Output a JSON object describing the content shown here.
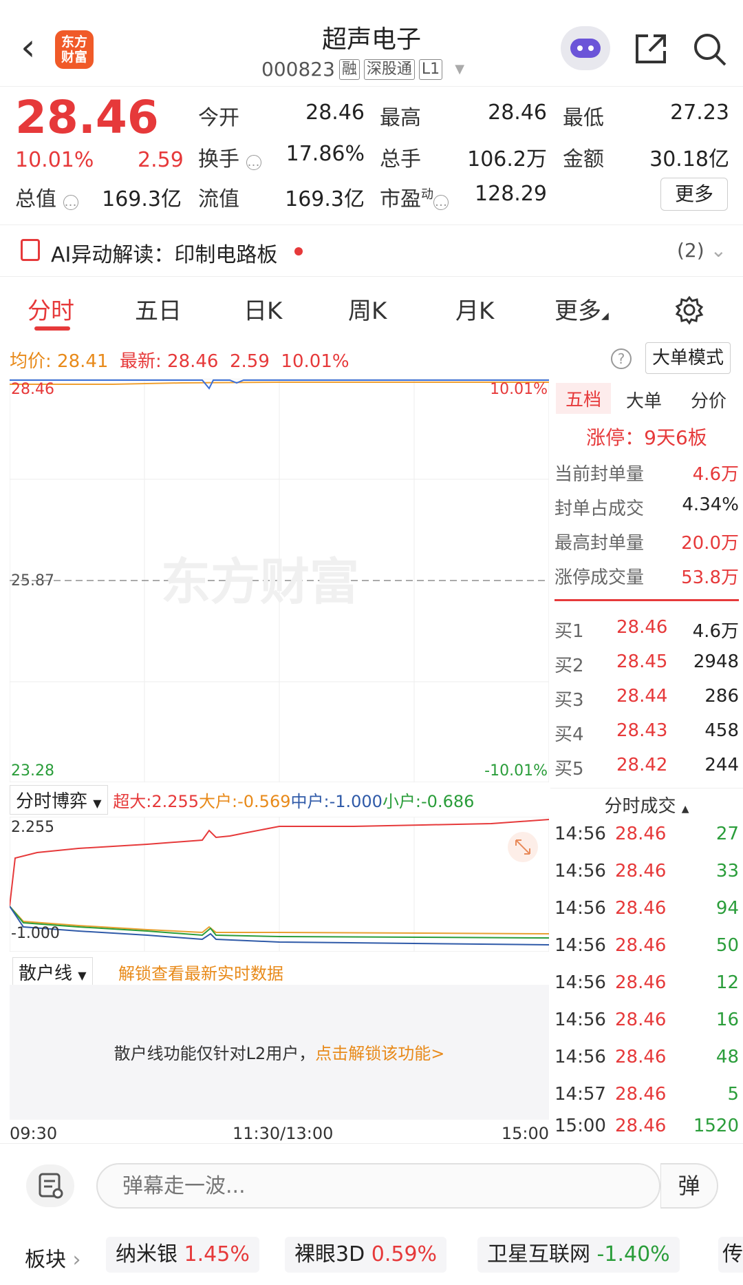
{
  "header": {
    "back_icon": "chevron-left-icon",
    "logo_text": "东方财富",
    "stock_name": "超声电子",
    "stock_code": "000823",
    "tags": [
      "融",
      "深股通",
      "L1"
    ]
  },
  "quote": {
    "price": "28.46",
    "change_pct": "10.01%",
    "change": "2.59",
    "fields": {
      "open_label": "今开",
      "open": "28.46",
      "high_label": "最高",
      "high": "28.46",
      "low_label": "最低",
      "low": "27.23",
      "turnover_label": "换手",
      "turnover": "17.86%",
      "volume_label": "总手",
      "volume": "106.2万",
      "amount_label": "金额",
      "amount": "30.18亿",
      "mktcap_label": "总值",
      "mktcap": "169.3亿",
      "float_label": "流值",
      "float": "169.3亿",
      "pe_label": "市盈",
      "pe_sup": "动",
      "pe": "128.29"
    },
    "more_label": "更多"
  },
  "ai": {
    "label": "AI异动解读：印制电路板",
    "count": "(2)"
  },
  "tabs": [
    "分时",
    "五日",
    "日K",
    "周K",
    "月K",
    "更多"
  ],
  "chart": {
    "avg_label": "均价:",
    "avg": "28.41",
    "latest_label": "最新:",
    "latest": "28.46",
    "latest_chg": "2.59",
    "latest_pct": "10.01%",
    "big_order_mode": "大单模式",
    "y_top": "28.46",
    "y_mid": "25.87",
    "y_bot": "23.28",
    "pct_top": "10.01%",
    "pct_bot": "-10.01%",
    "watermark": "东方财富",
    "colors": {
      "price_line": "#3a6fd8",
      "avg_line": "#f0a030",
      "up": "#e6393a",
      "down": "#2a9d3a"
    }
  },
  "flow": {
    "selector": "分时博弈",
    "super_label": "超大:2.255",
    "big_label": "大户:-0.569",
    "mid_label": "中户:-1.000",
    "small_label": "小户:-0.686",
    "y_top": "2.255",
    "y_bot": "-1.000"
  },
  "scatter": {
    "selector": "散户线",
    "unlock_hint": "解锁查看最新实时数据",
    "body": "散户线功能仅针对L2用户，",
    "link": "点击解锁该功能>"
  },
  "time_axis": [
    "09:30",
    "11:30/13:00",
    "15:00"
  ],
  "right_panel": {
    "tabs": [
      "五档",
      "大单",
      "分价"
    ],
    "limit_title": "涨停：9天6板",
    "limit_rows": [
      {
        "label": "当前封单量",
        "value": "4.6万"
      },
      {
        "label": "封单占成交",
        "value": "4.34%"
      },
      {
        "label": "最高封单量",
        "value": "20.0万"
      },
      {
        "label": "涨停成交量",
        "value": "53.8万"
      }
    ],
    "bids": [
      {
        "label": "买1",
        "price": "28.46",
        "qty": "4.6万"
      },
      {
        "label": "买2",
        "price": "28.45",
        "qty": "2948"
      },
      {
        "label": "买3",
        "price": "28.44",
        "qty": "286"
      },
      {
        "label": "买4",
        "price": "28.43",
        "qty": "458"
      },
      {
        "label": "买5",
        "price": "28.42",
        "qty": "244"
      }
    ],
    "ticks_title": "分时成交",
    "ticks": [
      {
        "time": "14:56",
        "price": "28.46",
        "qty": "27"
      },
      {
        "time": "14:56",
        "price": "28.46",
        "qty": "33"
      },
      {
        "time": "14:56",
        "price": "28.46",
        "qty": "94"
      },
      {
        "time": "14:56",
        "price": "28.46",
        "qty": "50"
      },
      {
        "time": "14:56",
        "price": "28.46",
        "qty": "12"
      },
      {
        "time": "14:56",
        "price": "28.46",
        "qty": "16"
      },
      {
        "time": "14:56",
        "price": "28.46",
        "qty": "48"
      },
      {
        "time": "14:57",
        "price": "28.46",
        "qty": "5"
      },
      {
        "time": "15:00",
        "price": "28.46",
        "qty": "1520"
      }
    ]
  },
  "bottom": {
    "danmu_placeholder": "弹幕走一波...",
    "danmu_button": "弹"
  },
  "sectors": {
    "label": "板块",
    "items": [
      {
        "name": "纳米银",
        "pct": "1.45%"
      },
      {
        "name": "裸眼3D",
        "pct": "0.59%"
      },
      {
        "name": "卫星互联网",
        "pct": "-1.40%"
      },
      {
        "name": "传",
        "pct": ""
      }
    ]
  }
}
